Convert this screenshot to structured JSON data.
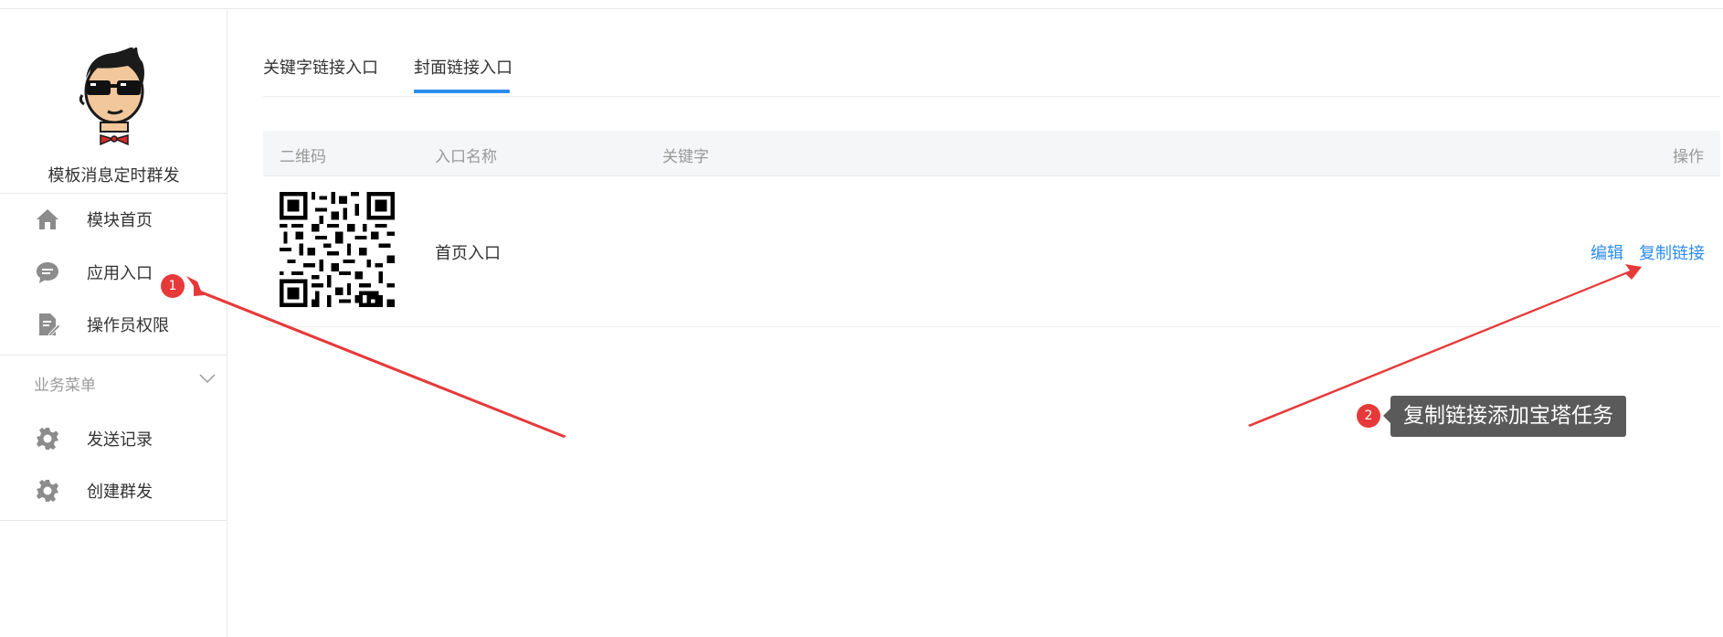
{
  "sidebar": {
    "app_name": "模板消息定时群发",
    "items": [
      {
        "label": "模块首页",
        "icon": "home-icon"
      },
      {
        "label": "应用入口",
        "icon": "chat-bubble-icon"
      },
      {
        "label": "操作员权限",
        "icon": "document-edit-icon"
      }
    ],
    "group": {
      "title": "业务菜单",
      "items": [
        {
          "label": "发送记录",
          "icon": "gear-icon"
        },
        {
          "label": "创建群发",
          "icon": "gear-icon"
        }
      ]
    }
  },
  "tabs": [
    {
      "label": "关键字链接入口",
      "active": false
    },
    {
      "label": "封面链接入口",
      "active": true
    }
  ],
  "table": {
    "headers": [
      "二维码",
      "入口名称",
      "关键字",
      "操作"
    ],
    "rows": [
      {
        "name": "首页入口",
        "keyword": "",
        "actions": [
          "编辑",
          "复制链接"
        ]
      }
    ]
  },
  "annotations": {
    "badge1": "1",
    "badge2": "2",
    "callout": "复制链接添加宝塔任务"
  },
  "colors": {
    "accent": "#2d8cf0",
    "annotation_red": "#e63a3a",
    "callout_bg": "#5a5a5a"
  }
}
